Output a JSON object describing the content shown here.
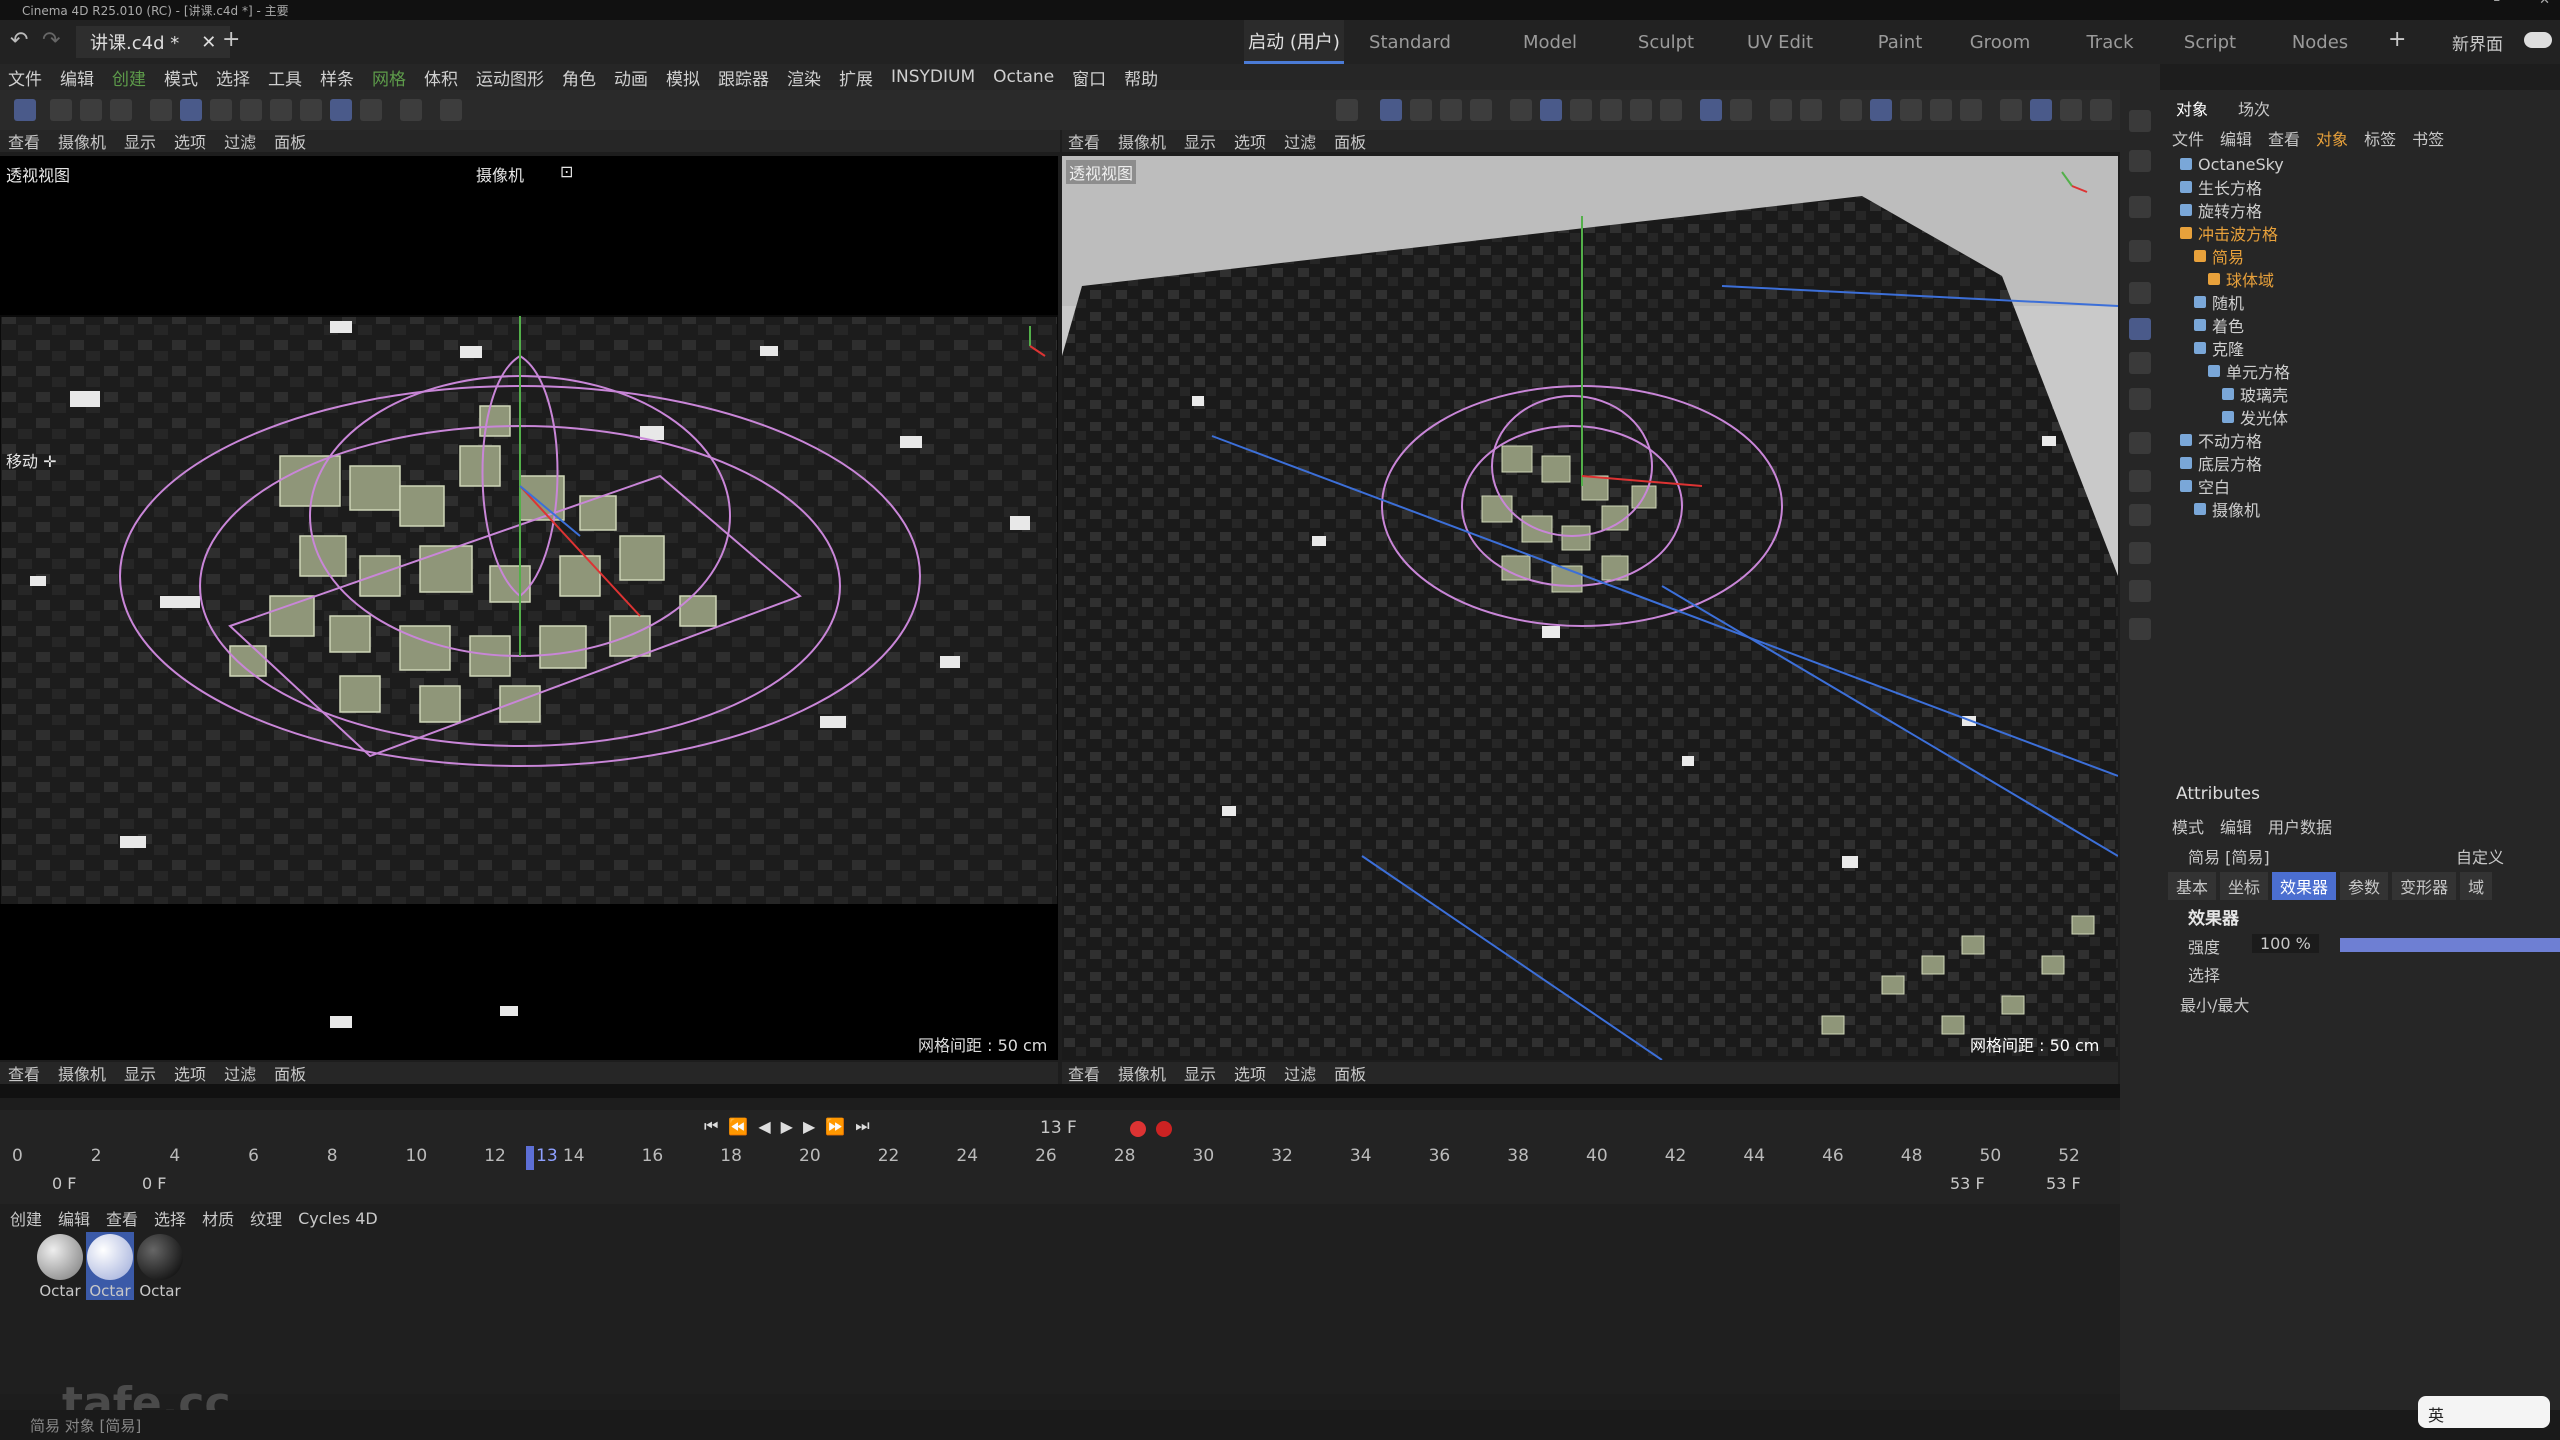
{
  "title_bar": {
    "text": "Cinema 4D R25.010 (RC) - [讲课.c4d *] - 主要"
  },
  "file_tab": "讲课.c4d *",
  "layout_tabs": [
    "启动 (用户)",
    "Standard",
    "Model",
    "Sculpt",
    "UV Edit",
    "Paint",
    "Groom",
    "Track",
    "Script",
    "Nodes"
  ],
  "new_ui_label": "新界面",
  "menu": [
    "文件",
    "编辑",
    "创建",
    "模式",
    "选择",
    "工具",
    "样条",
    "网格",
    "体积",
    "运动图形",
    "角色",
    "动画",
    "模拟",
    "跟踪器",
    "渲染",
    "扩展",
    "INSYDIUM",
    "Octane",
    "窗口",
    "帮助"
  ],
  "viewport_menu": [
    "查看",
    "摄像机",
    "显示",
    "选项",
    "过滤",
    "面板"
  ],
  "viewport_left": {
    "name": "透视视图",
    "camera": "摄像机",
    "move": "移动 ✛",
    "grid": "网格间距 : 50 cm"
  },
  "viewport_right": {
    "name": "透视视图",
    "grid": "网格间距 : 50 cm"
  },
  "obj_tabs": [
    "对象",
    "场次"
  ],
  "obj_menu": [
    "文件",
    "编辑",
    "查看",
    "对象",
    "标签",
    "书签"
  ],
  "objects": [
    {
      "name": "OctaneSky",
      "color": "normal"
    },
    {
      "name": "生长方格",
      "color": "normal"
    },
    {
      "name": "旋转方格",
      "color": "normal"
    },
    {
      "name": "冲击波方格",
      "color": "orange"
    },
    {
      "name": "简易",
      "color": "orange"
    },
    {
      "name": "球体域",
      "color": "orange"
    },
    {
      "name": "随机",
      "color": "normal"
    },
    {
      "name": "着色",
      "color": "normal"
    },
    {
      "name": "克隆",
      "color": "normal"
    },
    {
      "name": "单元方格",
      "color": "normal"
    },
    {
      "name": "玻璃壳",
      "color": "normal"
    },
    {
      "name": "发光体",
      "color": "normal"
    },
    {
      "name": "不动方格",
      "color": "normal"
    },
    {
      "name": "底层方格",
      "color": "normal"
    },
    {
      "name": "空白",
      "color": "normal"
    },
    {
      "name": "摄像机",
      "color": "normal"
    }
  ],
  "attributes": {
    "title": "Attributes",
    "menu": [
      "模式",
      "编辑",
      "用户数据"
    ],
    "object": "简易 [简易]",
    "preset": "自定义",
    "tabs": [
      "基本",
      "坐标",
      "效果器",
      "参数",
      "变形器",
      "域"
    ],
    "section": "效果器",
    "strength_label": "强度",
    "strength_value": "100 %",
    "strength_fraction": 1.0,
    "select_label": "选择",
    "minmax_label": "最小/最大"
  },
  "timeline": {
    "frame": "13 F",
    "ticks": [
      "0",
      "2",
      "4",
      "6",
      "8",
      "10",
      "12",
      "14",
      "16",
      "18",
      "20",
      "22",
      "24",
      "26",
      "28",
      "30",
      "32",
      "34",
      "36",
      "38",
      "40",
      "42",
      "44",
      "46",
      "48",
      "50",
      "52"
    ],
    "current_marker": "13",
    "start": "0 F",
    "start2": "0 F",
    "end": "53 F",
    "end2": "53 F"
  },
  "material_menu": [
    "创建",
    "编辑",
    "查看",
    "选择",
    "材质",
    "纹理",
    "Cycles 4D"
  ],
  "materials": [
    "Octar",
    "Octar",
    "Octar"
  ],
  "status": "简易 对象 [简易]",
  "watermark": "tafe.cc",
  "ime": "英"
}
